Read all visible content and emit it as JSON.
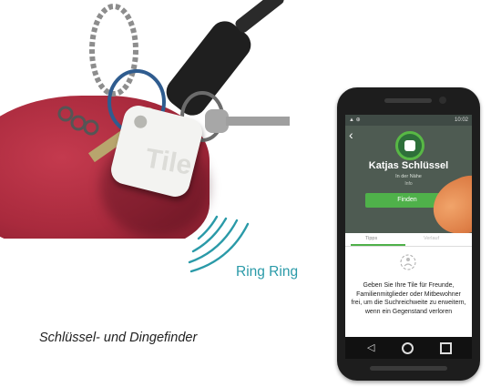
{
  "photo": {
    "tile_brand": "Tile"
  },
  "ring_label": "Ring Ring",
  "caption": "Schlüssel- und Dingefinder",
  "phone": {
    "status_time": "10:02",
    "title": "Katjas Schlüssel",
    "subtitle": "In der Nähe",
    "subtitle_small": "Info",
    "find_button": "Finden",
    "tab_1": "Tipps",
    "tab_2": "Verlauf",
    "share_text": "Geben Sie Ihre Tile für Freunde, Familienmitglieder oder Mitbewohner frei, um die Suchreichweite zu erweitern, wenn ein Gegenstand verloren"
  },
  "colors": {
    "ring_label": "#2a9aa8",
    "accent_green": "#4fb14a"
  }
}
